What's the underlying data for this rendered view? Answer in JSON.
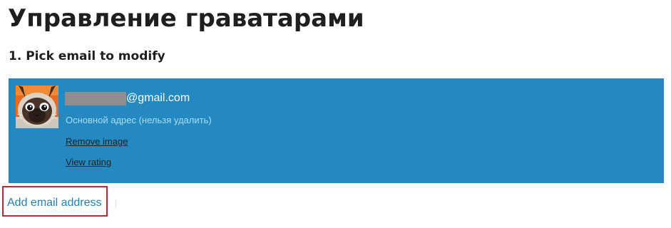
{
  "page": {
    "title": "Управление граватарами"
  },
  "section": {
    "heading": "1. Pick email to modify"
  },
  "email_card": {
    "avatar_icon": "cat-avatar-icon",
    "email_domain": "@gmail.com",
    "primary_note": "Основной адрес (нельзя удалить)",
    "remove_image_label": "Remove image",
    "view_rating_label": "View rating"
  },
  "actions": {
    "add_email_label": "Add email address"
  },
  "colors": {
    "card_background": "#2589c1",
    "link_blue": "#2180b3",
    "highlight_red": "#cf2030",
    "redaction_gray": "#8e8e8e"
  }
}
